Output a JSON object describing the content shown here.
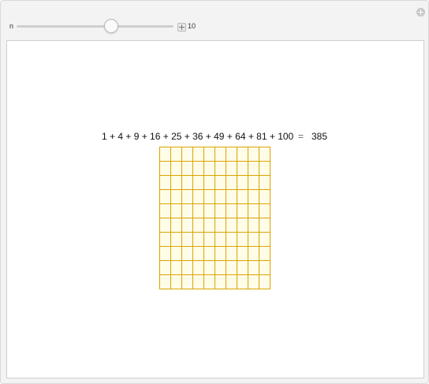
{
  "controls": {
    "label": "n",
    "value": "10",
    "slider_fraction": 0.6
  },
  "equation": {
    "terms": "1 + 4 + 9 + 16 + 25 + 36 + 49 + 64 + 81 + 100",
    "equals": "=",
    "result": "385"
  },
  "grid": {
    "rows": 10,
    "cols": 10,
    "line_color": "#d9a300",
    "fill_color": "#fffde8"
  },
  "icons": {
    "close": "close-icon",
    "plus": "plus-icon"
  }
}
